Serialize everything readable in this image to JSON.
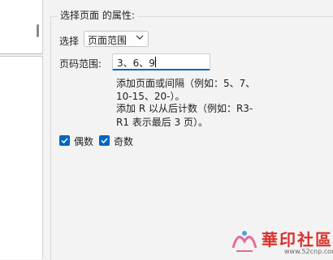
{
  "group": {
    "title": "选择页面 的属性:"
  },
  "selector": {
    "label": "选择",
    "value": "页面范围"
  },
  "page_range": {
    "label": "页码范围:",
    "value": "3、6、9",
    "help_lines": [
      "添加页面或间隔（例如：5、7、",
      "10-15、20-）。",
      "添加 R 以从后计数（例如：R3-",
      "R1 表示最后 3 页）。"
    ]
  },
  "options": {
    "even_label": "偶数",
    "odd_label": "奇数",
    "even_checked": true,
    "odd_checked": true
  },
  "watermark": {
    "title": "華印社區",
    "url": "www.52cnp.com"
  },
  "icons": {
    "chevron": "chevron-down-icon",
    "check": "checkmark-icon"
  },
  "colors": {
    "accent": "#0067c0",
    "watermark": "#d9302c"
  }
}
